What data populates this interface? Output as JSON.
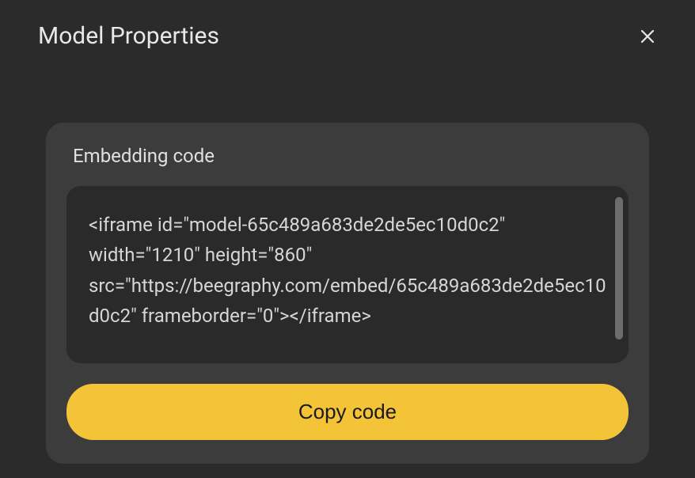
{
  "modal": {
    "title": "Model Properties"
  },
  "embedding": {
    "label": "Embedding code",
    "code": "<iframe id=\"model-65c489a683de2de5ec10d0c2\" width=\"1210\" height=\"860\" src=\"https://beegraphy.com/embed/65c489a683de2de5ec10d0c2\" frameborder=\"0\"></iframe>",
    "copy_button_label": "Copy code"
  }
}
